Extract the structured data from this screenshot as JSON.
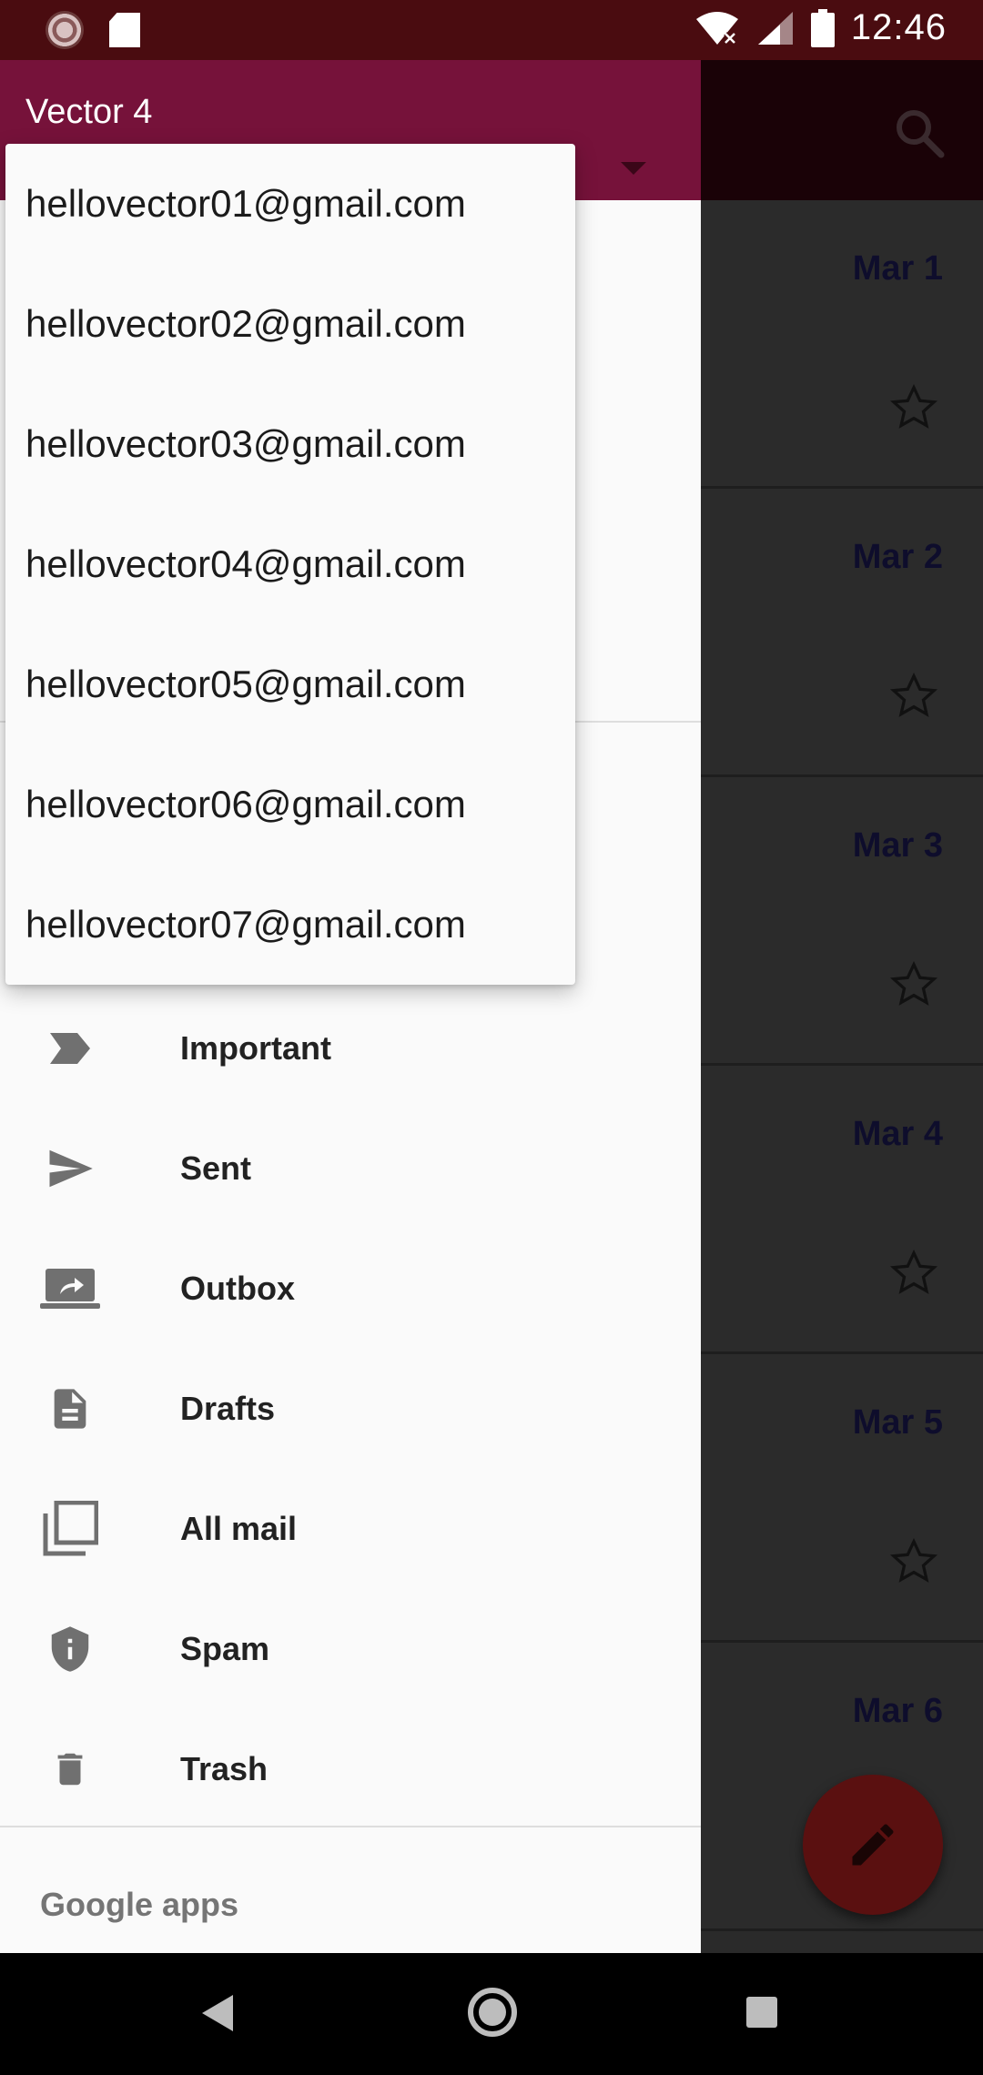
{
  "status_bar": {
    "time": "12:46",
    "icons": [
      "app-notification-icon",
      "sd-card-icon",
      "wifi-icon",
      "signal-icon",
      "battery-icon"
    ]
  },
  "drawer": {
    "account_name": "Vector 4",
    "account_switcher_icon": "dropdown-caret-icon",
    "accounts": [
      "hellovector01@gmail.com",
      "hellovector02@gmail.com",
      "hellovector03@gmail.com",
      "hellovector04@gmail.com",
      "hellovector05@gmail.com",
      "hellovector06@gmail.com",
      "hellovector07@gmail.com"
    ],
    "items": [
      {
        "label": "Important",
        "icon": "important-icon"
      },
      {
        "label": "Sent",
        "icon": "send-icon"
      },
      {
        "label": "Outbox",
        "icon": "outbox-icon"
      },
      {
        "label": "Drafts",
        "icon": "drafts-icon"
      },
      {
        "label": "All mail",
        "icon": "all-mail-icon"
      },
      {
        "label": "Spam",
        "icon": "spam-icon"
      },
      {
        "label": "Trash",
        "icon": "trash-icon"
      }
    ],
    "footer_section": "Google apps"
  },
  "mail_list": {
    "dates": [
      "Mar 1",
      "Mar 2",
      "Mar 3",
      "Mar 4",
      "Mar 5",
      "Mar 6"
    ]
  },
  "colors": {
    "status_bar": "#4a0c10",
    "drawer_header": "#76123a",
    "drawer_background": "#fafafa",
    "fab": "#5a1010",
    "date_text": "#0e0d2c"
  }
}
